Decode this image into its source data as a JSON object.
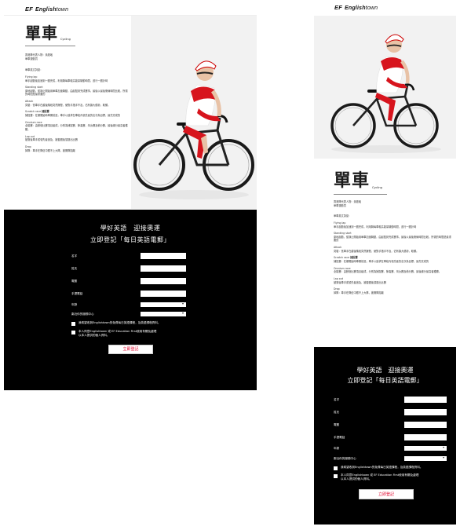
{
  "brand": {
    "ef": "EF",
    "name_bold": "English",
    "name_light": "town"
  },
  "article": {
    "title_zh": "單車",
    "title_en": "Cycling",
    "rep_line1": "香港隊代表人物：黃蘊瑤",
    "rep_line2": "單車運動員",
    "section_label": "單車英文詞彙：",
    "terms": [
      {
        "en": "Flying lap",
        "zh": "",
        "desc": "單手起動後加速到一圈完成，利用騎每車較高能量騎動時間，進行一圈計時"
      },
      {
        "en": "Standing start",
        "zh": "",
        "desc": "原地起動，從靜止開始用單車加速騎動，由起點到完成賽事，最後以最後衝線時間比較，所需的時間是最重要的"
      },
      {
        "en": "Attack",
        "zh": "",
        "desc": "突襲：當車手在越後階段突然爆發，使對手措手不及，佔有擴大優勢，取勝。"
      },
      {
        "en": "Scratch race",
        "zh": "捕捉賽",
        "desc": "捕捉賽：在爆開始時車團前進，車手以追求在車段內領先者的名次為目標，最先完成的"
      },
      {
        "en": "Omnium race",
        "zh": "",
        "desc": "全能賽：由數個比賽項目組成，分別為捕捉賽、節奏賽、淘汰賽及積分賽，最後總分最高者獲勝。"
      },
      {
        "en": "Lap out",
        "zh": "",
        "desc": "被落後車手或領先者追及，被套圈後須退出比賽"
      },
      {
        "en": "Drop",
        "zh": "",
        "desc": "掉隊：車手在隊伍中跟不上大隊，被團隊拋離"
      }
    ]
  },
  "form": {
    "heading_line1": "學好英語　迎接奧運",
    "heading_line2": "立即登記「每日英語電郵」",
    "fields": [
      {
        "label": "名字"
      },
      {
        "label": "姓氏"
      },
      {
        "label": "電郵"
      },
      {
        "label": "手提電話"
      }
    ],
    "selects": [
      {
        "label": "年齡",
        "caret": "▾"
      },
      {
        "label": "鄰近你的服務中心",
        "caret": "▾"
      }
    ],
    "checkbox1": "我希望收到Englishtown的免費每日英語課程，及英語課程資料。",
    "checkbox2_line1": "本人同意Englishtown 或 EF Education First使用有關及處理",
    "checkbox2_line2": "以本人提供的個人資料。",
    "submit_label": "立即登記",
    "accent_color": "#e0002a"
  }
}
